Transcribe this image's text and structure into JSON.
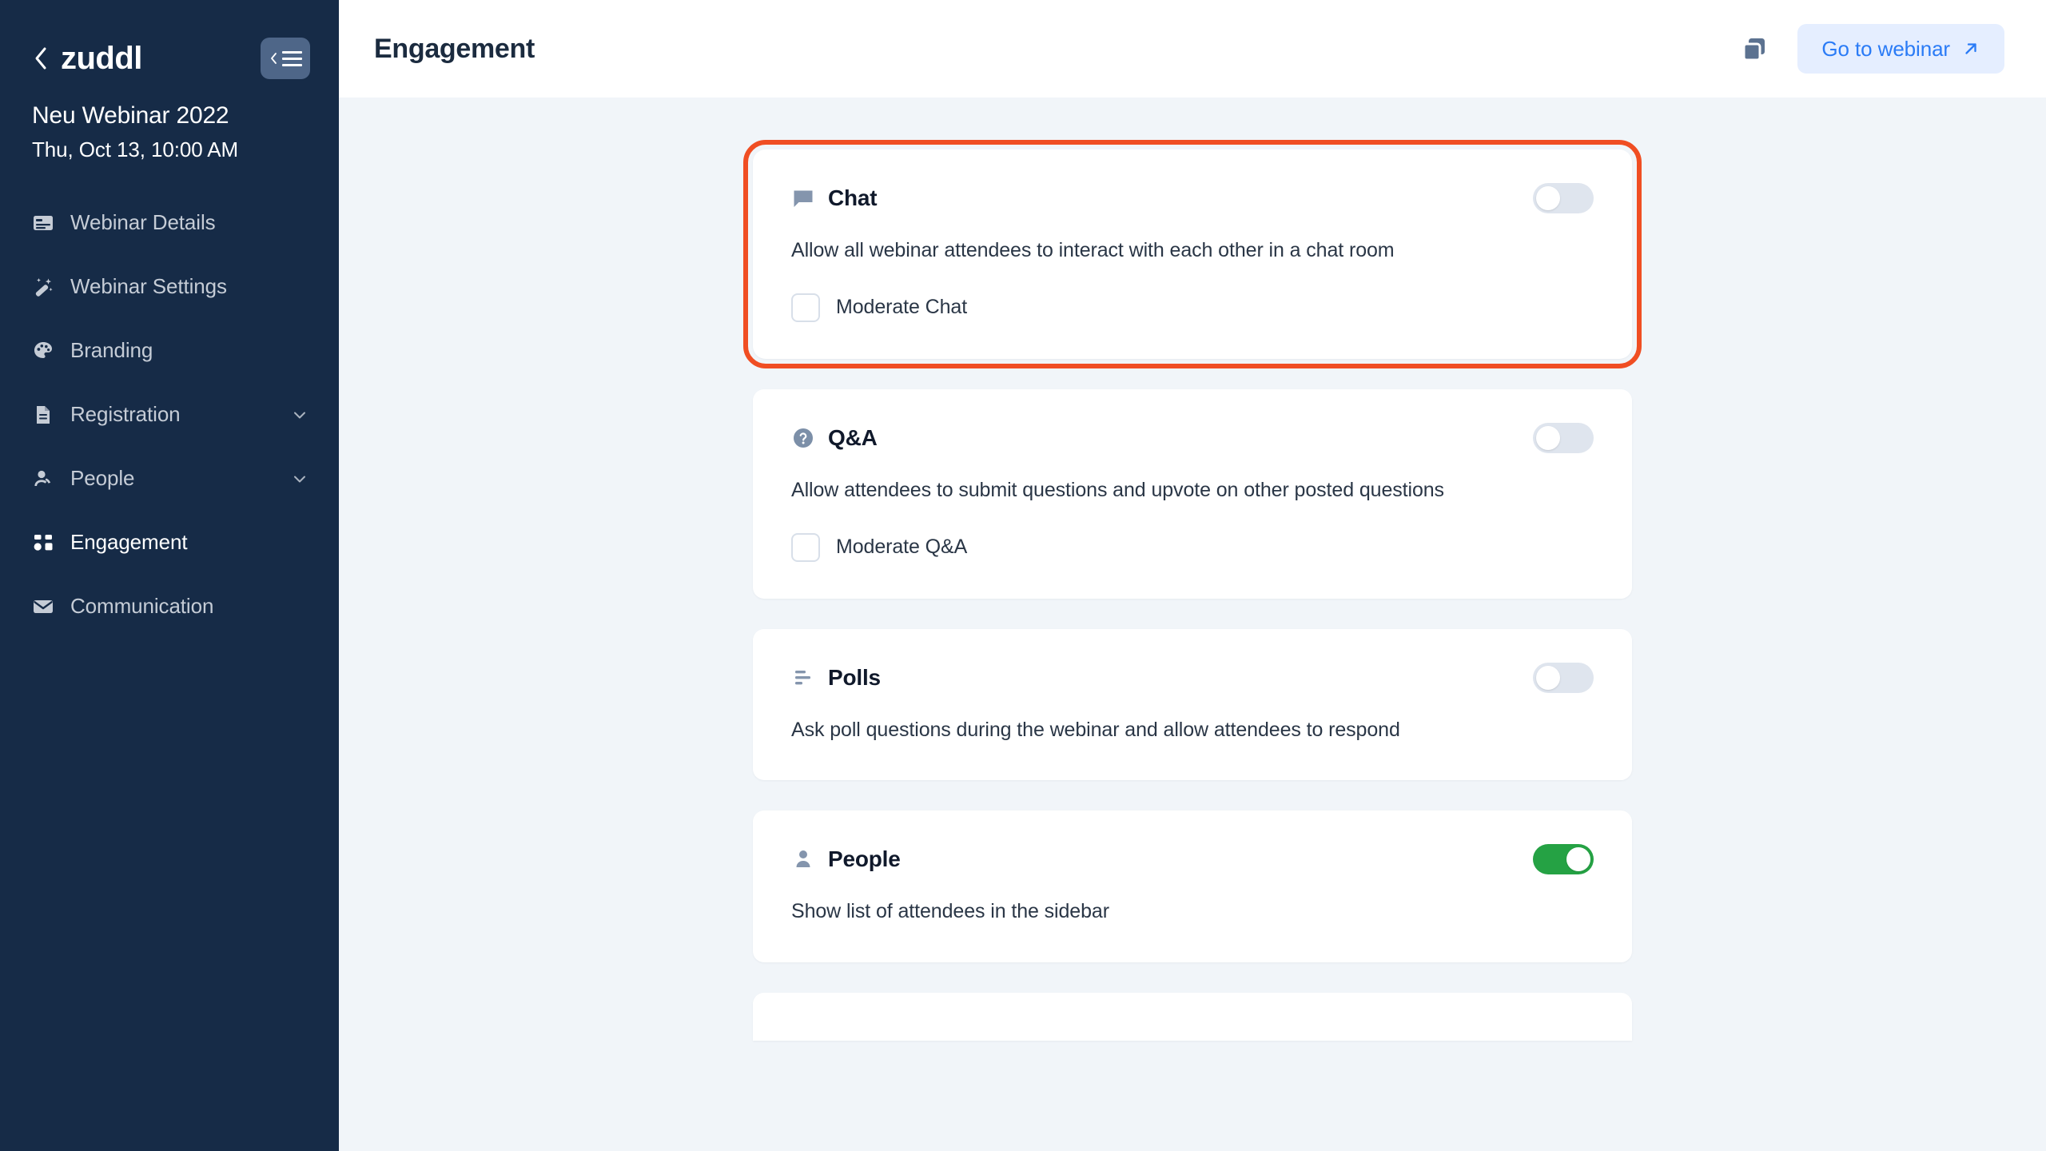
{
  "sidebar": {
    "brand": "zuddl",
    "back_icon": "chevron-left-icon",
    "collapse_icon": "collapse-sidebar-icon",
    "webinar_name": "Neu Webinar 2022",
    "webinar_date": "Thu, Oct 13, 10:00 AM",
    "items": [
      {
        "label": "Webinar Details",
        "icon": "card-details-icon",
        "active": false,
        "expandable": false
      },
      {
        "label": "Webinar Settings",
        "icon": "magic-wand-icon",
        "active": false,
        "expandable": false
      },
      {
        "label": "Branding",
        "icon": "palette-icon",
        "active": false,
        "expandable": false
      },
      {
        "label": "Registration",
        "icon": "document-icon",
        "active": false,
        "expandable": true
      },
      {
        "label": "People",
        "icon": "person-icon",
        "active": false,
        "expandable": true
      },
      {
        "label": "Engagement",
        "icon": "grid-squares-icon",
        "active": true,
        "expandable": false
      },
      {
        "label": "Communication",
        "icon": "envelope-icon",
        "active": false,
        "expandable": false
      }
    ]
  },
  "header": {
    "title": "Engagement",
    "copy_icon": "copy-duplicate-icon",
    "goto_webinar_label": "Go to webinar",
    "goto_webinar_icon": "arrow-up-right-icon"
  },
  "colors": {
    "sidebar_bg": "#162b47",
    "accent_blue": "#2a7bf6",
    "highlight_outline": "#f04e23",
    "toggle_on": "#25a244",
    "toggle_off": "#dfe5ee",
    "page_bg": "#f1f5f9"
  },
  "cards": [
    {
      "id": "chat",
      "title": "Chat",
      "icon": "chat-bubble-icon",
      "description": "Allow all webinar attendees to interact with each other in a chat room",
      "toggle_on": false,
      "highlighted": true,
      "checkbox": {
        "label": "Moderate Chat",
        "checked": false
      }
    },
    {
      "id": "qa",
      "title": "Q&A",
      "icon": "question-circle-icon",
      "description": "Allow attendees to submit questions and upvote on other posted questions",
      "toggle_on": false,
      "highlighted": false,
      "checkbox": {
        "label": "Moderate Q&A",
        "checked": false
      }
    },
    {
      "id": "polls",
      "title": "Polls",
      "icon": "poll-bars-icon",
      "description": "Ask poll questions during the webinar and allow attendees to respond",
      "toggle_on": false,
      "highlighted": false,
      "checkbox": null
    },
    {
      "id": "people",
      "title": "People",
      "icon": "person-icon",
      "description": "Show list of attendees in the sidebar",
      "toggle_on": true,
      "highlighted": false,
      "checkbox": null
    }
  ]
}
